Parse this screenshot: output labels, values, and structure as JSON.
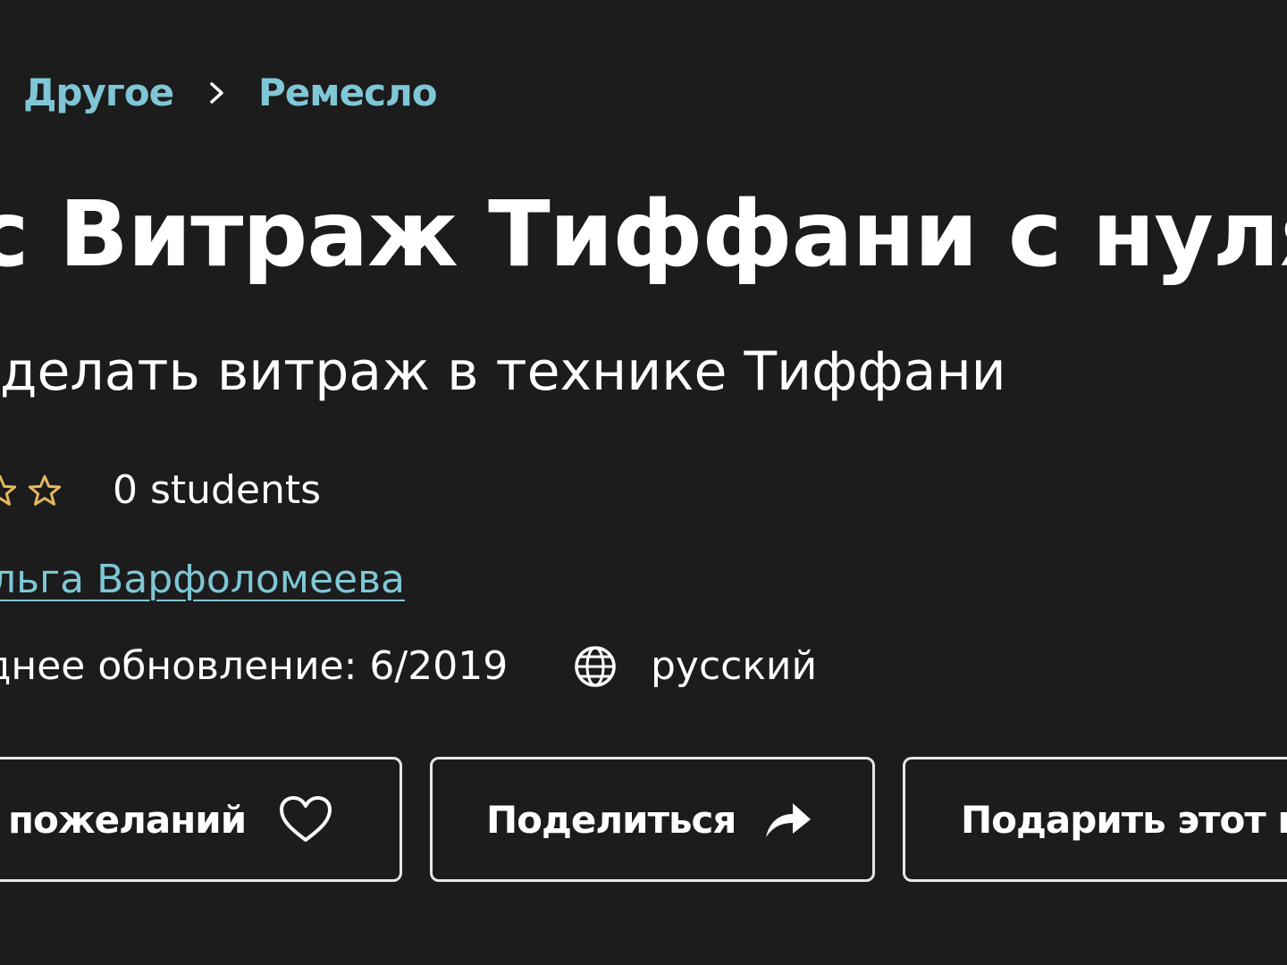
{
  "breadcrumb": {
    "items": [
      "Другое",
      "Ремесло"
    ],
    "separator_icon": "chevron-right-icon"
  },
  "course": {
    "title": "с Витраж Тиффани с нуля",
    "subtitle": "делать витраж в технике Тиффани",
    "rating": {
      "visible_stars": 2,
      "star_icon": "star-outline-icon"
    },
    "students": "0 students",
    "author": "льга Варфоломеева",
    "updated": "днее обновление: 6/2019",
    "language_icon": "globe-icon",
    "language": "русский"
  },
  "actions": {
    "wishlist": {
      "label": "пожеланий",
      "icon": "heart-icon"
    },
    "share": {
      "label": "Поделиться",
      "icon": "share-arrow-icon"
    },
    "gift": {
      "label": "Подарить этот к"
    }
  },
  "colors": {
    "background": "#1c1c1c",
    "text": "#ffffff",
    "link": "#7fc6d6",
    "button_border": "#e6e6e6"
  }
}
